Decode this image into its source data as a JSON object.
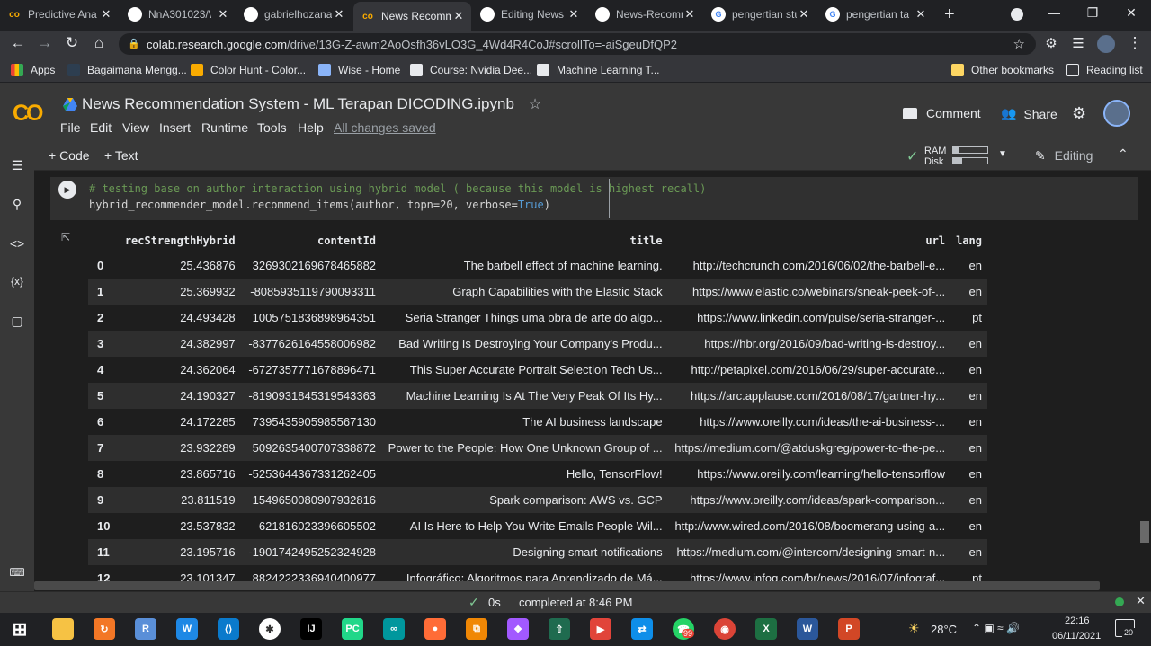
{
  "browser": {
    "tabs": [
      {
        "title": "Predictive Ana",
        "favicon": "colab-icon",
        "color": "#f9ab00",
        "active": false
      },
      {
        "title": "NnA301023/\\",
        "favicon": "github-icon",
        "color": "#ffffff",
        "active": false
      },
      {
        "title": "gabrielhozana",
        "favicon": "github-icon",
        "color": "#ffffff",
        "active": false
      },
      {
        "title": "News Recomm",
        "favicon": "colab-icon",
        "color": "#f9ab00",
        "active": true
      },
      {
        "title": "Editing News",
        "favicon": "github-icon",
        "color": "#ffffff",
        "active": false
      },
      {
        "title": "News-Recomm",
        "favicon": "github-icon",
        "color": "#ffffff",
        "active": false
      },
      {
        "title": "pengertian stu",
        "favicon": "google-icon",
        "color": "#ffffff",
        "active": false
      },
      {
        "title": "pengertian ta",
        "favicon": "google-icon",
        "color": "#ffffff",
        "active": false
      }
    ],
    "new_tab": "+",
    "url_host": "colab.research.google.com",
    "url_path": "/drive/13G-Z-awm2AoOsfh36vLO3G_4Wd4R4CoJ#scrollTo=-aiSgeuDfQP2",
    "bookmarks": [
      {
        "label": "Apps",
        "icon": "apps-grid-icon"
      },
      {
        "label": "Bagaimana Mengg...",
        "icon": "dicoding-icon"
      },
      {
        "label": "Color Hunt - Color...",
        "icon": "colorhunt-icon"
      },
      {
        "label": "Wise - Home",
        "icon": "wise-icon"
      },
      {
        "label": "Course: Nvidia Dee...",
        "icon": "course-icon"
      },
      {
        "label": "Machine Learning T...",
        "icon": "ml-icon"
      }
    ],
    "other_bookmarks": "Other bookmarks",
    "reading_list": "Reading list"
  },
  "colab": {
    "notebook_title": "News Recommendation System - ML Terapan DICODING.ipynb",
    "menu": [
      "File",
      "Edit",
      "View",
      "Insert",
      "Runtime",
      "Tools",
      "Help"
    ],
    "saved_status": "All changes saved",
    "comment_label": "Comment",
    "share_label": "Share",
    "add_code": "+ Code",
    "add_text": "+ Text",
    "ram_label": "RAM",
    "disk_label": "Disk",
    "ram_usage_fraction": 0.15,
    "disk_usage_fraction": 0.25,
    "editing_label": "Editing"
  },
  "cell": {
    "comment_line": "# testing base on author interaction using hybrid model ( because this model is highest recall)",
    "code_prefix": "hybrid_recommender_model.recommend_items(author, topn=20, verbose=",
    "code_true": "True",
    "code_suffix": ")"
  },
  "table": {
    "columns": [
      "",
      "recStrengthHybrid",
      "contentId",
      "title",
      "url",
      "lang"
    ],
    "rows": [
      [
        "0",
        "25.436876",
        "3269302169678465882",
        "The barbell effect of machine learning.",
        "http://techcrunch.com/2016/06/02/the-barbell-e...",
        "en"
      ],
      [
        "1",
        "25.369932",
        "-8085935119790093311",
        "Graph Capabilities with the Elastic Stack",
        "https://www.elastic.co/webinars/sneak-peek-of-...",
        "en"
      ],
      [
        "2",
        "24.493428",
        "1005751836898964351",
        "Seria Stranger Things uma obra de arte do algo...",
        "https://www.linkedin.com/pulse/seria-stranger-...",
        "pt"
      ],
      [
        "3",
        "24.382997",
        "-8377626164558006982",
        "Bad Writing Is Destroying Your Company's Produ...",
        "https://hbr.org/2016/09/bad-writing-is-destroy...",
        "en"
      ],
      [
        "4",
        "24.362064",
        "-6727357771678896471",
        "This Super Accurate Portrait Selection Tech Us...",
        "http://petapixel.com/2016/06/29/super-accurate...",
        "en"
      ],
      [
        "5",
        "24.190327",
        "-8190931845319543363",
        "Machine Learning Is At The Very Peak Of Its Hy...",
        "https://arc.applause.com/2016/08/17/gartner-hy...",
        "en"
      ],
      [
        "6",
        "24.172285",
        "7395435905985567130",
        "The AI business landscape",
        "https://www.oreilly.com/ideas/the-ai-business-...",
        "en"
      ],
      [
        "7",
        "23.932289",
        "5092635400707338872",
        "Power to the People: How One Unknown Group of ...",
        "https://medium.com/@atduskgreg/power-to-the-pe...",
        "en"
      ],
      [
        "8",
        "23.865716",
        "-5253644367331262405",
        "Hello, TensorFlow!",
        "https://www.oreilly.com/learning/hello-tensorflow",
        "en"
      ],
      [
        "9",
        "23.811519",
        "1549650080907932816",
        "Spark comparison: AWS vs. GCP",
        "https://www.oreilly.com/ideas/spark-comparison...",
        "en"
      ],
      [
        "10",
        "23.537832",
        "621816023396605502",
        "AI Is Here to Help You Write Emails People Wil...",
        "http://www.wired.com/2016/08/boomerang-using-a...",
        "en"
      ],
      [
        "11",
        "23.195716",
        "-1901742495252324928",
        "Designing smart notifications",
        "https://medium.com/@intercom/designing-smart-n...",
        "en"
      ],
      [
        "12",
        "23.101347",
        "8824222336940400977",
        "Infográfico: Algoritmos para Aprendizado de Má...",
        "https://www.infoq.com/br/news/2016/07/infograf...",
        "pt"
      ]
    ]
  },
  "status": {
    "check": "✓",
    "duration": "0s",
    "completed": "completed at 8:46 PM"
  },
  "taskbar": {
    "weather": "28°C",
    "time": "22:16",
    "date": "06/11/2021",
    "notifications": "20",
    "whatsapp_badge": "99"
  }
}
